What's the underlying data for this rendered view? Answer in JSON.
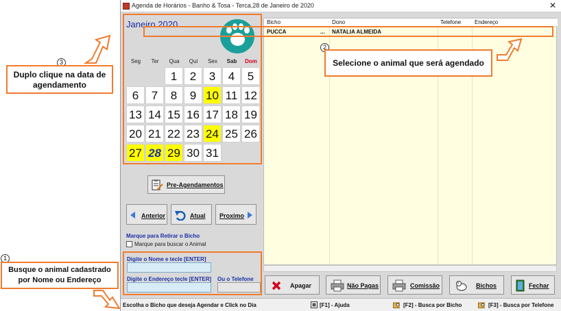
{
  "window": {
    "title": "Agenda de Horários - Banho & Tosa - Terca,28 de Janeiro de 2020",
    "close_glyph": "✕"
  },
  "calendar": {
    "month": "Janeiro 2020",
    "weekdays": [
      "Seg",
      "Ter",
      "Qua",
      "Qui",
      "Sex",
      "Sab",
      "Dom"
    ],
    "days": [
      "1",
      "2",
      "3",
      "4",
      "5",
      "6",
      "7",
      "8",
      "9",
      "10",
      "11",
      "12",
      "13",
      "14",
      "15",
      "16",
      "17",
      "18",
      "19",
      "20",
      "21",
      "22",
      "23",
      "24",
      "25",
      "26",
      "27",
      "28",
      "29",
      "30",
      "31"
    ],
    "highlighted_days": [
      "10",
      "24",
      "27",
      "28",
      "29"
    ],
    "today": "28",
    "first_weekday_index": 2
  },
  "buttons": {
    "pre_agendamentos": "Pre-Agendamentos",
    "anterior": "Anterior",
    "atual": "Atual",
    "proximo": "Proximo",
    "apagar": "Apagar",
    "nao_pagas": "Não Pagas",
    "comissao": "Comissão",
    "bichos": "Bichos",
    "fechar": "Fechar"
  },
  "options": {
    "title": "Marque para Retirar o Bicho",
    "checkbox_label": "Marque para buscar o Animal",
    "checked": false
  },
  "search": {
    "name_label": "Digite o Nome e tecle [ENTER]",
    "address_label": "Digite o Endereço tecle [ENTER]",
    "phone_label": "Ou o Telefone",
    "name_value": "",
    "address_value": "",
    "phone_value": ""
  },
  "grid": {
    "columns": [
      "Bicho",
      "Dono",
      "Telefone",
      "Endereço"
    ],
    "rows": [
      {
        "bicho": "PUCCA",
        "ellipsis": "...",
        "dono": "NATALIA ALMEIDA",
        "telefone": "",
        "endereco": ""
      }
    ]
  },
  "status": {
    "hint": "Escolha o Bicho que deseja Agendar e Click no Dia",
    "f1": "[F1] - Ajuda",
    "f2": "[F2] - Busca por Bicho",
    "f3": "[F3] - Busca por Telefone"
  },
  "callouts": {
    "c1": {
      "num": "1",
      "text": "Busque o animal cadastrado por Nome ou Endereço"
    },
    "c2": {
      "num": "2",
      "text": "Selecione o animal que será agendado"
    },
    "c3": {
      "num": "3",
      "text": "Duplo clique na data de agendamento"
    }
  },
  "colors": {
    "accent": "#f07b2e",
    "highlight": "#ffff00",
    "link_blue": "#1a2fa8",
    "teal": "#1aa09a",
    "grid_bg": "#fffee0"
  }
}
